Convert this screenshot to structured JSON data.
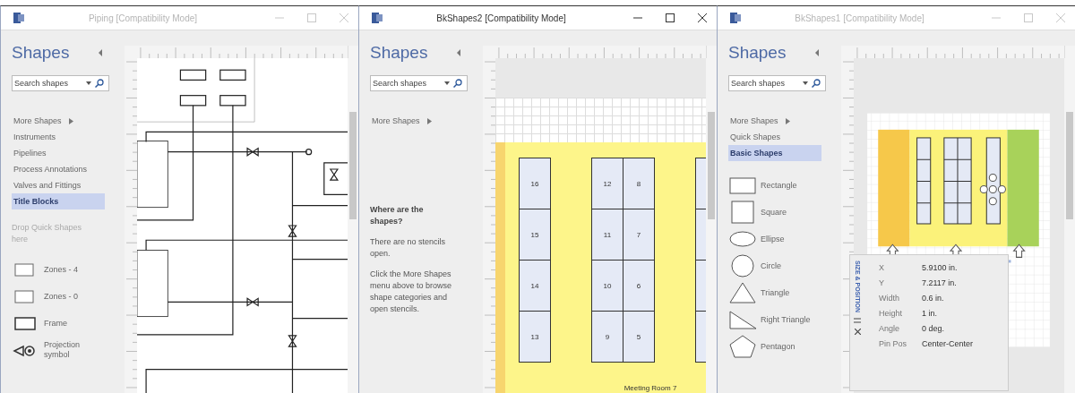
{
  "windows": [
    {
      "title": "Piping [Compatibility Mode]",
      "active": false,
      "shapes": {
        "heading": "Shapes",
        "search_placeholder": "Search shapes",
        "items": [
          {
            "label": "More Shapes",
            "kind": "menu",
            "selected": false
          },
          {
            "label": "Instruments",
            "kind": "stencil",
            "selected": false
          },
          {
            "label": "Pipelines",
            "kind": "stencil",
            "selected": false
          },
          {
            "label": "Process Annotations",
            "kind": "stencil",
            "selected": false
          },
          {
            "label": "Valves and Fittings",
            "kind": "stencil",
            "selected": false
          },
          {
            "label": "Title Blocks",
            "kind": "stencil",
            "selected": true
          }
        ],
        "drop_hint": "Drop Quick Shapes here",
        "masters": [
          {
            "label": "Zones - 4",
            "kind": "zone"
          },
          {
            "label": "Zones - 0",
            "kind": "zone"
          },
          {
            "label": "Frame",
            "kind": "frame"
          },
          {
            "label": "Projection symbol",
            "kind": "projection"
          }
        ]
      },
      "canvas": {
        "kind": "piping"
      }
    },
    {
      "title": "BkShapes2 [Compatibility Mode]",
      "active": true,
      "shapes": {
        "heading": "Shapes",
        "search_placeholder": "Search shapes",
        "items": [
          {
            "label": "More Shapes",
            "kind": "menu",
            "selected": false
          }
        ],
        "help": {
          "heading": "Where are the shapes?",
          "paragraphs": [
            "There are no stencils open.",
            "Click the More Shapes menu above to browse shape categories and open stencils."
          ]
        }
      },
      "canvas": {
        "kind": "seating",
        "columns": [
          {
            "rows": [
              [
                "16"
              ],
              [
                "15"
              ],
              [
                "14"
              ],
              [
                "13"
              ]
            ]
          },
          {
            "rows": [
              [
                "12",
                "8"
              ],
              [
                "11",
                "7"
              ],
              [
                "10",
                "6"
              ],
              [
                "9",
                "5"
              ]
            ]
          }
        ],
        "caption": "Meeting Room 7"
      }
    },
    {
      "title": "BkShapes1 [Compatibility Mode]",
      "active": false,
      "shapes": {
        "heading": "Shapes",
        "search_placeholder": "Search shapes",
        "items": [
          {
            "label": "More Shapes",
            "kind": "menu",
            "selected": false
          },
          {
            "label": "Quick Shapes",
            "kind": "stencil",
            "selected": false
          },
          {
            "label": "Basic Shapes",
            "kind": "stencil",
            "selected": true
          }
        ],
        "masters": [
          {
            "label": "Rectangle",
            "kind": "rectangle"
          },
          {
            "label": "Square",
            "kind": "square"
          },
          {
            "label": "Ellipse",
            "kind": "ellipse"
          },
          {
            "label": "Circle",
            "kind": "circle"
          },
          {
            "label": "Triangle",
            "kind": "triangle"
          },
          {
            "label": "Right Triangle",
            "kind": "right-triangle"
          },
          {
            "label": "Pentagon",
            "kind": "pentagon"
          }
        ]
      },
      "canvas": {
        "kind": "floorplan",
        "size_position": {
          "title": "SIZE & POSITION",
          "rows": [
            {
              "label": "X",
              "value": "5.9100 in."
            },
            {
              "label": "Y",
              "value": "7.2117 in."
            },
            {
              "label": "Width",
              "value": "0.6 in."
            },
            {
              "label": "Height",
              "value": "1 in."
            },
            {
              "label": "Angle",
              "value": "0 deg."
            },
            {
              "label": "Pin Pos",
              "value": "Center-Center"
            }
          ]
        }
      }
    }
  ]
}
